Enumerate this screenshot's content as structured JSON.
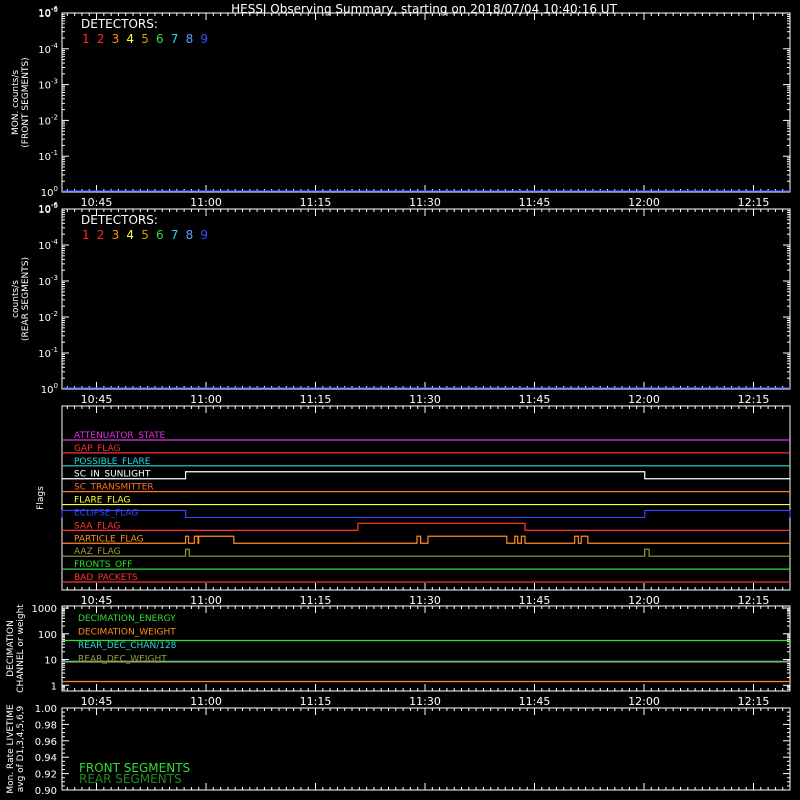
{
  "title": "HESSI Observing Summary, starting on 2018/07/04 10:40:16 UT",
  "colors": {
    "background": "#000000",
    "axes": "#ffffff",
    "detectors": [
      "#ff2a2a",
      "#ff2a2a",
      "#ff8c1a",
      "#ffff33",
      "#c8a000",
      "#33dd33",
      "#22dddd",
      "#5aa0ff",
      "#3050ff"
    ]
  },
  "chart_data": [
    {
      "type": "line",
      "name": "front-counts",
      "ylabel": [
        "MON. counts/s",
        "(FRONT SEGMENTS)"
      ],
      "yscale": "log",
      "ylim": [
        1,
        100000
      ],
      "yticks": [
        {
          "value": 1,
          "base": "10",
          "exp": "0"
        },
        {
          "value": 10,
          "base": "10",
          "exp": "-1"
        },
        {
          "value": 100,
          "base": "10",
          "exp": "-2"
        },
        {
          "value": 1000,
          "base": "10",
          "exp": "-3"
        },
        {
          "value": 10000,
          "base": "10",
          "exp": "-4"
        },
        {
          "value": 100000,
          "base": "10",
          "exp": "-5"
        },
        {
          "value": 1000000,
          "base": "10",
          "exp": "-6"
        }
      ],
      "xticks": [
        "10:45",
        "11:00",
        "11:15",
        "11:30",
        "11:45",
        "12:00",
        "12:15"
      ],
      "xtick_minutes": [
        45,
        60,
        75,
        90,
        105,
        120,
        135
      ],
      "xlim_minutes": [
        40.27,
        140
      ],
      "legend_title": "DETECTORS:",
      "legend_entries": [
        "1",
        "2",
        "3",
        "4",
        "5",
        "6",
        "7",
        "8",
        "9"
      ],
      "series": [
        {
          "color": "#3050ff",
          "values": [
            1,
            1
          ]
        }
      ]
    },
    {
      "type": "line",
      "name": "rear-counts",
      "ylabel": [
        "counts/s",
        "(REAR SEGMENTS)"
      ],
      "yscale": "log",
      "ylim": [
        1,
        100000
      ],
      "yticks": [
        {
          "value": 1,
          "base": "10",
          "exp": "0"
        },
        {
          "value": 10,
          "base": "10",
          "exp": "-1"
        },
        {
          "value": 100,
          "base": "10",
          "exp": "-2"
        },
        {
          "value": 1000,
          "base": "10",
          "exp": "-3"
        },
        {
          "value": 10000,
          "base": "10",
          "exp": "-4"
        },
        {
          "value": 100000,
          "base": "10",
          "exp": "-5"
        },
        {
          "value": 1000000,
          "base": "10",
          "exp": "-6"
        }
      ],
      "xticks": [
        "10:45",
        "11:00",
        "11:15",
        "11:30",
        "11:45",
        "12:00",
        "12:15"
      ],
      "xtick_minutes": [
        45,
        60,
        75,
        90,
        105,
        120,
        135
      ],
      "xlim_minutes": [
        40.27,
        140
      ],
      "legend_title": "DETECTORS:",
      "legend_entries": [
        "1",
        "2",
        "3",
        "4",
        "5",
        "6",
        "7",
        "8",
        "9"
      ],
      "series": [
        {
          "color": "#3050ff",
          "values": [
            1,
            1
          ]
        }
      ]
    },
    {
      "type": "line",
      "name": "flags",
      "ylabel": [
        "Flags"
      ],
      "xticks": [
        "10:45",
        "11:00",
        "11:15",
        "11:30",
        "11:45",
        "12:00",
        "12:15"
      ],
      "xtick_minutes": [
        45,
        60,
        75,
        90,
        105,
        120,
        135
      ],
      "xlim_minutes": [
        40.27,
        140
      ],
      "flags": [
        {
          "label": "ATTENUATOR_STATE",
          "color": "#dd33dd",
          "segments": []
        },
        {
          "label": "GAP_FLAG",
          "color": "#ff3333",
          "segments": []
        },
        {
          "label": "POSSIBLE_FLARE",
          "color": "#22dddd",
          "segments": []
        },
        {
          "label": "SC_IN_SUNLIGHT",
          "color": "#ffffff",
          "segments": [
            [
              57.2,
              120.1
            ]
          ]
        },
        {
          "label": "SC_TRANSMITTER",
          "color": "#ff7020",
          "segments": []
        },
        {
          "label": "FLARE_FLAG",
          "color": "#ffff33",
          "segments": []
        },
        {
          "label": "ECLIPSE_FLAG",
          "color": "#3344ff",
          "segments": [
            [
              40.27,
              57.2
            ],
            [
              120.1,
              140
            ]
          ]
        },
        {
          "label": "SAA_FLAG",
          "color": "#ff3333",
          "segments": [
            [
              80.8,
              103.7
            ]
          ]
        },
        {
          "label": "PARTICLE_FLAG",
          "color": "#ff8c1a",
          "segments": [
            [
              57.2,
              57.6
            ],
            [
              58.4,
              58.9
            ],
            [
              59.0,
              63.8
            ],
            [
              88.9,
              89.4
            ],
            [
              90.4,
              101.2
            ],
            [
              102.3,
              102.7
            ],
            [
              103.2,
              103.7
            ],
            [
              110.5,
              111.0
            ],
            [
              111.4,
              112.3
            ]
          ]
        },
        {
          "label": "AAZ_FLAG",
          "color": "#9a9a3a",
          "segments": [
            [
              57.2,
              57.7
            ],
            [
              120.1,
              120.7
            ]
          ]
        },
        {
          "label": "FRONTS_OFF",
          "color": "#33dd33",
          "segments": []
        },
        {
          "label": "BAD_PACKETS",
          "color": "#ff3333",
          "segments": []
        }
      ]
    },
    {
      "type": "line",
      "name": "decimation",
      "ylabel": [
        "DECIMATION",
        "CHANNEL or weight"
      ],
      "yscale": "log",
      "ylim": [
        0.6,
        1200
      ],
      "yticks": [
        {
          "value": 1,
          "label": "1"
        },
        {
          "value": 10,
          "label": "10"
        },
        {
          "value": 100,
          "label": "100"
        },
        {
          "value": 1000,
          "label": "1000"
        }
      ],
      "xticks": [
        "10:45",
        "11:00",
        "11:15",
        "11:30",
        "11:45",
        "12:00",
        "12:15"
      ],
      "xtick_minutes": [
        45,
        60,
        75,
        90,
        105,
        120,
        135
      ],
      "xlim_minutes": [
        40.27,
        140
      ],
      "series": [
        {
          "name": "DECIMATION_ENERGY",
          "color": "#33dd33",
          "values": [
            55,
            55
          ]
        },
        {
          "name": "DECIMATION_WEIGHT",
          "color": "#ff8c1a",
          "values": [
            1.4,
            1.4
          ]
        },
        {
          "name": "REAR_DEC_CHAN/128",
          "color": "#22dddd",
          "values": [
            8.5,
            8.5
          ]
        },
        {
          "name": "REAR_DEC_WEIGHT",
          "color": "#9a9a3a",
          "values": [
            8.0,
            8.0
          ]
        }
      ]
    },
    {
      "type": "line",
      "name": "livetime",
      "ylabel": [
        "Mon. Rate LIVETIME",
        "avg of D1,3,4,5,6,9"
      ],
      "ylim": [
        0.9,
        1.0
      ],
      "yticks": [
        {
          "value": 0.9,
          "label": "0.90"
        },
        {
          "value": 0.92,
          "label": "0.92"
        },
        {
          "value": 0.94,
          "label": "0.94"
        },
        {
          "value": 0.96,
          "label": "0.96"
        },
        {
          "value": 0.98,
          "label": "0.98"
        },
        {
          "value": 1.0,
          "label": "1.00"
        }
      ],
      "xlim_minutes": [
        40.27,
        140
      ],
      "legend_entries": [
        {
          "label": "FRONT SEGMENTS",
          "color": "#33dd33"
        },
        {
          "label": "REAR SEGMENTS",
          "color": "#228822"
        }
      ],
      "series": []
    }
  ]
}
